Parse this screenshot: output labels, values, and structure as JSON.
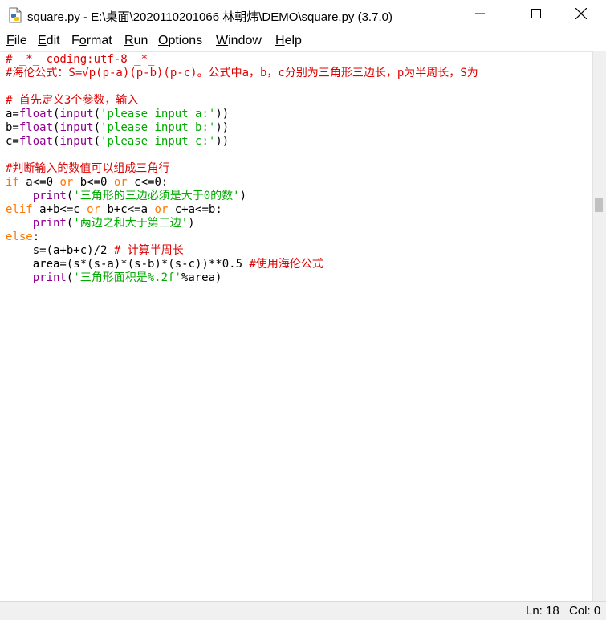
{
  "window": {
    "title": "square.py - E:\\桌面\\2020110201066 林朝炜\\DEMO\\square.py (3.7.0)",
    "controls": {
      "minimize": "minimize",
      "maximize": "maximize",
      "close": "close"
    }
  },
  "menu": [
    {
      "accel": "F",
      "rest": "ile"
    },
    {
      "accel": "E",
      "rest": "dit"
    },
    {
      "pre": "F",
      "accel": "o",
      "rest": "rmat"
    },
    {
      "accel": "R",
      "rest": "un"
    },
    {
      "accel": "O",
      "rest": "ptions"
    },
    {
      "accel": "W",
      "rest": "indow"
    },
    {
      "accel": "H",
      "rest": "elp"
    }
  ],
  "code": {
    "lines": [
      [
        [
          "# _*_ coding:utf-8 _*_",
          "comment"
        ]
      ],
      [
        [
          "#海伦公式：S=√p(p-a)(p-b)(p-c)。公式中a，b，c分别为三角形三边长，p为半周长，S为",
          "comment"
        ]
      ],
      [],
      [
        [
          "# 首先定义3个参数，输入",
          "comment"
        ]
      ],
      [
        [
          "a=",
          ""
        ],
        [
          "float",
          "bi"
        ],
        [
          "(",
          ""
        ],
        [
          "input",
          "bi"
        ],
        [
          "(",
          ""
        ],
        [
          "'please input a:'",
          "str"
        ],
        [
          "))",
          ""
        ]
      ],
      [
        [
          "b=",
          ""
        ],
        [
          "float",
          "bi"
        ],
        [
          "(",
          ""
        ],
        [
          "input",
          "bi"
        ],
        [
          "(",
          ""
        ],
        [
          "'please input b:'",
          "str"
        ],
        [
          "))",
          ""
        ]
      ],
      [
        [
          "c=",
          ""
        ],
        [
          "float",
          "bi"
        ],
        [
          "(",
          ""
        ],
        [
          "input",
          "bi"
        ],
        [
          "(",
          ""
        ],
        [
          "'please input c:'",
          "str"
        ],
        [
          "))",
          ""
        ]
      ],
      [],
      [
        [
          "#判断输入的数值可以组成三角行",
          "comment"
        ]
      ],
      [
        [
          "if",
          "kw"
        ],
        [
          " a<=0 ",
          ""
        ],
        [
          "or",
          "kw"
        ],
        [
          " b<=0 ",
          ""
        ],
        [
          "or",
          "kw"
        ],
        [
          " c<=0:",
          ""
        ]
      ],
      [
        [
          "    ",
          ""
        ],
        [
          "print",
          "bi"
        ],
        [
          "(",
          ""
        ],
        [
          "'三角形的三边必须是大于0的数'",
          "str"
        ],
        [
          ")",
          ""
        ]
      ],
      [
        [
          "elif",
          "kw"
        ],
        [
          " a+b<=c ",
          ""
        ],
        [
          "or",
          "kw"
        ],
        [
          " b+c<=a ",
          ""
        ],
        [
          "or",
          "kw"
        ],
        [
          " c+a<=b:",
          ""
        ]
      ],
      [
        [
          "    ",
          ""
        ],
        [
          "print",
          "bi"
        ],
        [
          "(",
          ""
        ],
        [
          "'两边之和大于第三边'",
          "str"
        ],
        [
          ")",
          ""
        ]
      ],
      [
        [
          "else",
          "kw"
        ],
        [
          ":",
          ""
        ]
      ],
      [
        [
          "    s=(a+b+c)/2 ",
          ""
        ],
        [
          "# 计算半周长",
          "comment"
        ]
      ],
      [
        [
          "    area=(s*(s-a)*(s-b)*(s-c))**0.5 ",
          ""
        ],
        [
          "#使用海伦公式",
          "comment"
        ]
      ],
      [
        [
          "    ",
          ""
        ],
        [
          "print",
          "bi"
        ],
        [
          "(",
          ""
        ],
        [
          "'三角形面积是%.2f'",
          "str"
        ],
        [
          "%area)",
          ""
        ]
      ]
    ]
  },
  "status": {
    "line": "Ln: 18",
    "col": "Col: 0"
  },
  "colors": {
    "comment": "#dd0000",
    "keyword": "#ff7700",
    "builtin": "#900090",
    "string": "#00aa00"
  }
}
